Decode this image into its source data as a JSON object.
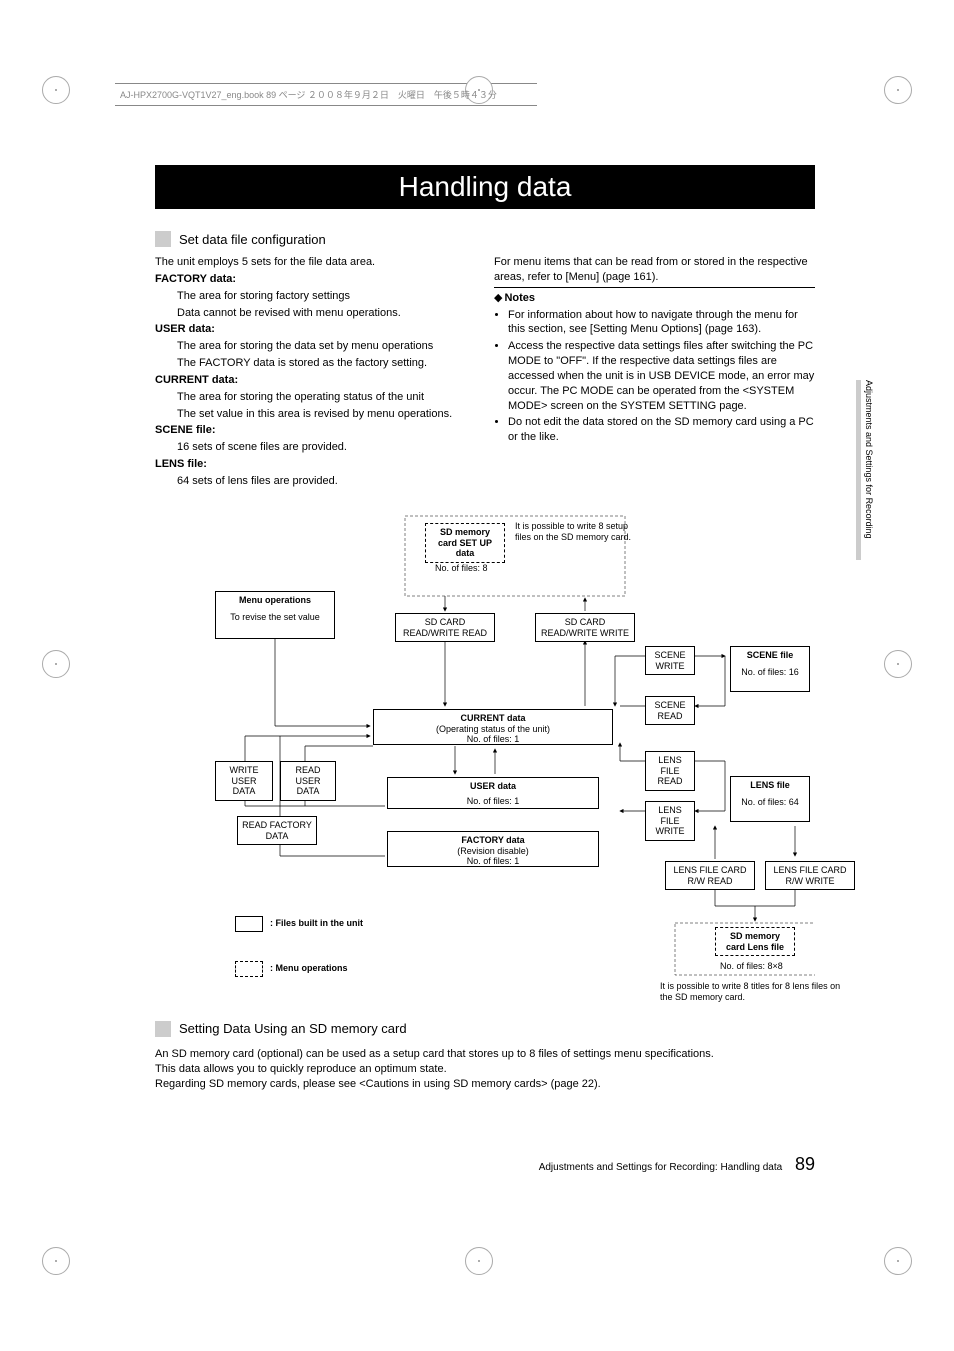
{
  "header_note": "AJ-HPX2700G-VQT1V27_eng.book  89 ページ  ２００８年９月２日　火曜日　午後５時４３分",
  "title": "Handling data",
  "section1_title": "Set data file configuration",
  "intro": "The unit employs 5 sets for the file data area.",
  "defs": {
    "factory_t": "FACTORY data:",
    "factory_d1": "The area for storing factory settings",
    "factory_d2": "Data cannot be revised with menu operations.",
    "user_t": "USER data:",
    "user_d1": "The area for storing the data set by menu operations",
    "user_d2": "The FACTORY data is stored as the factory setting.",
    "current_t": "CURRENT data:",
    "current_d1": "The area for storing the operating status of the unit",
    "current_d2": "The set value in this area is revised by menu operations.",
    "scene_t": "SCENE file:",
    "scene_d1": "16 sets of scene files are provided.",
    "lens_t": "LENS file:",
    "lens_d1": "64 sets of lens files are provided."
  },
  "right_intro": "For menu items that can be read from or stored in the respective areas, refer to [Menu] (page 161).",
  "notes_head": "Notes",
  "notes": {
    "n1": "For information about how to navigate through the menu for this section, see [Setting Menu Options] (page 163).",
    "n2": "Access the respective data settings files after switching the PC MODE to \"OFF\". If the respective data settings files are accessed when the unit is in USB DEVICE mode, an error may occur. The PC MODE can be operated from the <SYSTEM MODE> screen on the SYSTEM SETTING page.",
    "n3": "Do not edit the data stored on the SD memory card using a PC or the like."
  },
  "diagram": {
    "sd_setup_t": "SD memory card SET UP data",
    "sd_setup_n": "No. of files: 8",
    "sd_setup_note": "It is possible to write 8 setup files on the SD memory card.",
    "menu_ops": "Menu operations",
    "menu_sub": "To revise the set value",
    "sd_rw_read": "SD CARD READ/WRITE READ",
    "sd_rw_write": "SD CARD READ/WRITE WRITE",
    "scene_write": "SCENE WRITE",
    "scene_read": "SCENE READ",
    "scene_box_t": "SCENE file",
    "scene_box_n": "No. of files: 16",
    "lens_read": "LENS FILE READ",
    "lens_write": "LENS FILE WRITE",
    "lens_box_t": "LENS file",
    "lens_box_n": "No. of files: 64",
    "lens_card_r": "LENS FILE CARD R/W READ",
    "lens_card_w": "LENS FILE CARD R/W WRITE",
    "sd_lens_t": "SD memory card Lens file",
    "sd_lens_n": "No. of files: 8×8",
    "sd_lens_note": "It is possible to write 8 titles for 8 lens files on the SD memory card.",
    "current_t": "CURRENT data",
    "current_sub": "(Operating status of the unit)",
    "current_n": "No. of files: 1",
    "user_t": "USER data",
    "user_n": "No. of files: 1",
    "factory_t": "FACTORY data",
    "factory_sub": "(Revision disable)",
    "factory_n": "No. of files: 1",
    "write_user": "WRITE USER DATA",
    "read_user": "READ USER DATA",
    "read_factory": "READ FACTORY DATA",
    "legend1": ": Files built in the unit",
    "legend2": ": Menu operations"
  },
  "section2_title": "Setting Data Using an SD memory card",
  "section2_body": {
    "l1": "An SD memory card (optional) can be used as a setup card that stores up to 8 files of settings menu specifications.",
    "l2": "This data allows you to quickly reproduce an optimum state.",
    "l3": "Regarding SD memory cards, please see <Cautions in using SD memory cards> (page 22)."
  },
  "sidebar_text": "Adjustments and Settings for Recording",
  "footer_chapter": "Adjustments and Settings for Recording:",
  "footer_page_title": "Handling data",
  "page_number": "89"
}
